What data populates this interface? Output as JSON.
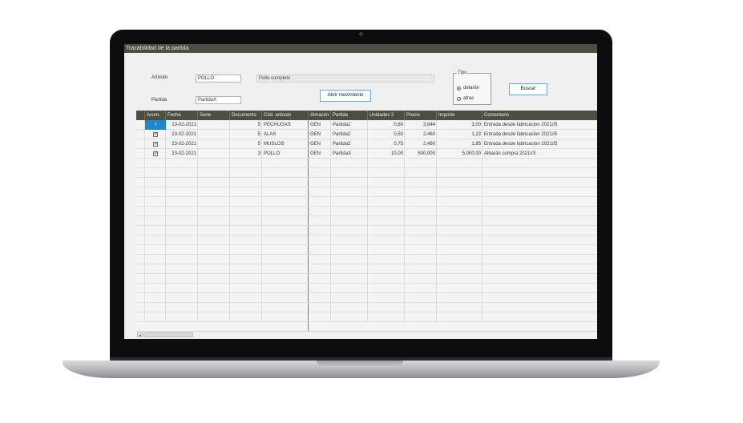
{
  "window": {
    "title": "Trazabilidad de la partida"
  },
  "form": {
    "articulo_label": "Articulo",
    "articulo_value": "POLLO",
    "articulo_desc": "Pollo completo",
    "partida_label": "Partida",
    "partida_value": "PartidaX",
    "abrir_label": "Abrir movimiento",
    "tipo_label": "Tipo",
    "tipo_options": [
      "delante",
      "atras"
    ],
    "tipo_selected": "delante",
    "buscar_label": "Buscar"
  },
  "table": {
    "columns": [
      "Acum.",
      "Fecha",
      "Serie",
      "Documento",
      "Cód. artículo",
      "Almacén",
      "Partida",
      "Unidades 2",
      "Precio",
      "Importe",
      "Comentario"
    ],
    "rows": [
      {
        "acum": true,
        "fecha": "23-02-2021",
        "serie": "",
        "documento": "5",
        "cod": "PECHUGAS",
        "almacen": "GEN",
        "partida": "Partida2",
        "unidades": "0,80",
        "precio": "3,844",
        "importe": "3,00",
        "comentario": "Entrada desde fabricacion 2021//5"
      },
      {
        "acum": true,
        "fecha": "23-02-2021",
        "serie": "",
        "documento": "5",
        "cod": "ALAS",
        "almacen": "GEN",
        "partida": "Partida2",
        "unidades": "0,50",
        "precio": "2,460",
        "importe": "1,23",
        "comentario": "Entrada desde fabricacion 2021//5"
      },
      {
        "acum": true,
        "fecha": "23-02-2021",
        "serie": "",
        "documento": "5",
        "cod": "MUSLOS",
        "almacen": "GEN",
        "partida": "Partida2",
        "unidades": "0,75",
        "precio": "2,460",
        "importe": "1,85",
        "comentario": "Entrada desde fabricacion 2021//5"
      },
      {
        "acum": true,
        "fecha": "23-02-2021",
        "serie": "",
        "documento": "3",
        "cod": "POLLO",
        "almacen": "GEN",
        "partida": "PartidaX",
        "unidades": "10,00",
        "precio": "500,000",
        "importe": "5.000,00",
        "comentario": "Albarán compra 2021//3"
      }
    ]
  },
  "icons": {
    "check": "✓",
    "scroll_left": "◂"
  },
  "colors": {
    "header": "#4d4d42",
    "selection": "#1e88c8"
  }
}
